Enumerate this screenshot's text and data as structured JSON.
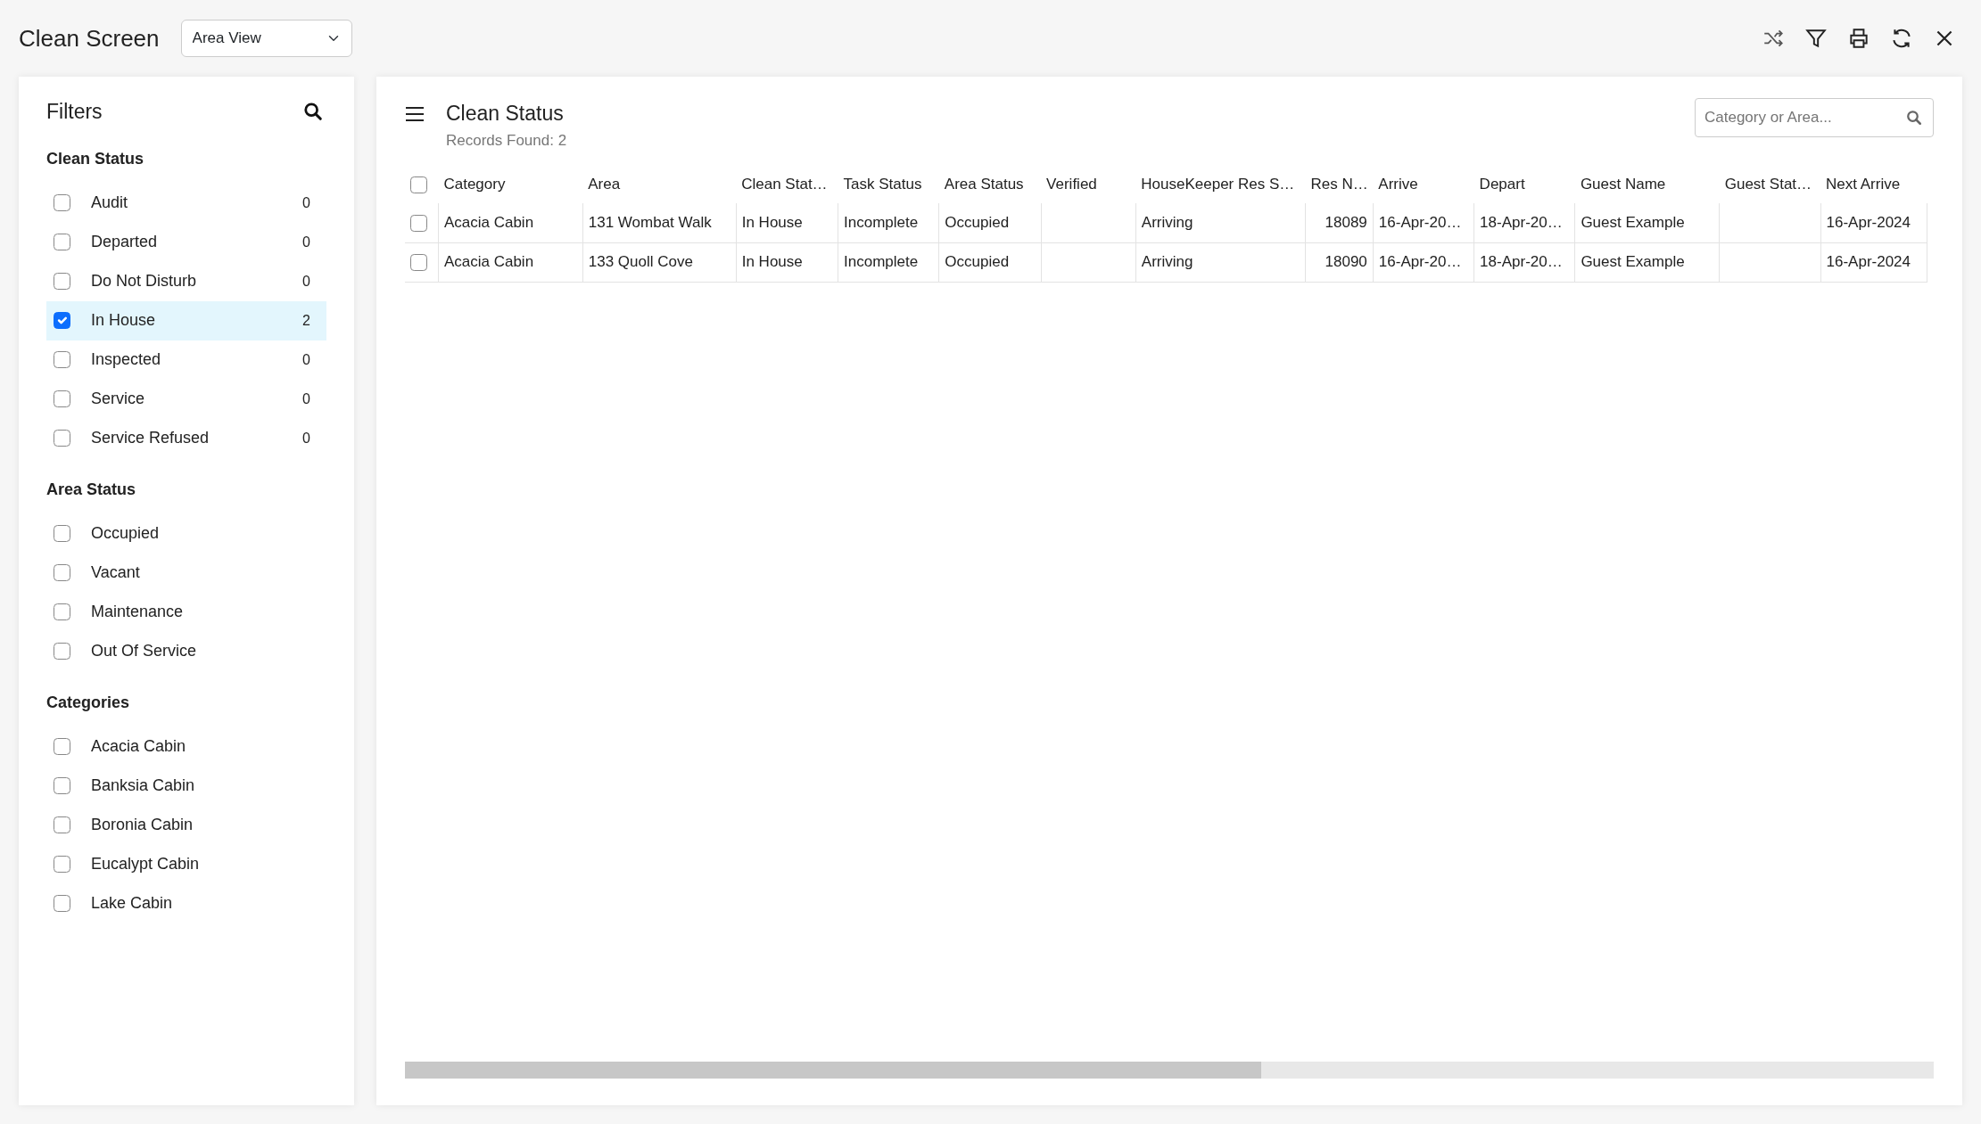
{
  "app": {
    "title": "Clean Screen",
    "view_select": "Area View"
  },
  "filters": {
    "title": "Filters",
    "groups": [
      {
        "title": "Clean Status",
        "items": [
          {
            "label": "Audit",
            "count": "0",
            "checked": false
          },
          {
            "label": "Departed",
            "count": "0",
            "checked": false
          },
          {
            "label": "Do Not Disturb",
            "count": "0",
            "checked": false
          },
          {
            "label": "In House",
            "count": "2",
            "checked": true
          },
          {
            "label": "Inspected",
            "count": "0",
            "checked": false
          },
          {
            "label": "Service",
            "count": "0",
            "checked": false
          },
          {
            "label": "Service Refused",
            "count": "0",
            "checked": false
          }
        ]
      },
      {
        "title": "Area Status",
        "items": [
          {
            "label": "Occupied",
            "checked": false
          },
          {
            "label": "Vacant",
            "checked": false
          },
          {
            "label": "Maintenance",
            "checked": false
          },
          {
            "label": "Out Of Service",
            "checked": false
          }
        ]
      },
      {
        "title": "Categories",
        "items": [
          {
            "label": "Acacia Cabin",
            "checked": false
          },
          {
            "label": "Banksia Cabin",
            "checked": false
          },
          {
            "label": "Boronia Cabin",
            "checked": false
          },
          {
            "label": "Eucalypt Cabin",
            "checked": false
          },
          {
            "label": "Lake Cabin",
            "checked": false
          }
        ]
      }
    ]
  },
  "panel": {
    "title": "Clean Status",
    "records": "Records Found: 2",
    "search": {
      "placeholder": "Category or Area..."
    }
  },
  "table": {
    "select_all": false,
    "columns": [
      "Category",
      "Area",
      "Clean Stat…",
      "Task Status",
      "Area Status",
      "Verified",
      "HouseKeeper Res S…",
      "Res N…",
      "Arrive",
      "Depart",
      "Guest Name",
      "Guest Stat…",
      "Next Arrive"
    ],
    "rows": [
      {
        "checked": false,
        "cells": [
          "Acacia Cabin",
          "131 Wombat Walk",
          "In House",
          "Incomplete",
          "Occupied",
          "",
          "Arriving",
          "18089",
          "16-Apr-20…",
          "18-Apr-20…",
          "Guest Example",
          "",
          "16-Apr-2024"
        ]
      },
      {
        "checked": false,
        "cells": [
          "Acacia Cabin",
          "133 Quoll Cove",
          "In House",
          "Incomplete",
          "Occupied",
          "",
          "Arriving",
          "18090",
          "16-Apr-20…",
          "18-Apr-20…",
          "Guest Example",
          "",
          "16-Apr-2024"
        ]
      }
    ]
  }
}
